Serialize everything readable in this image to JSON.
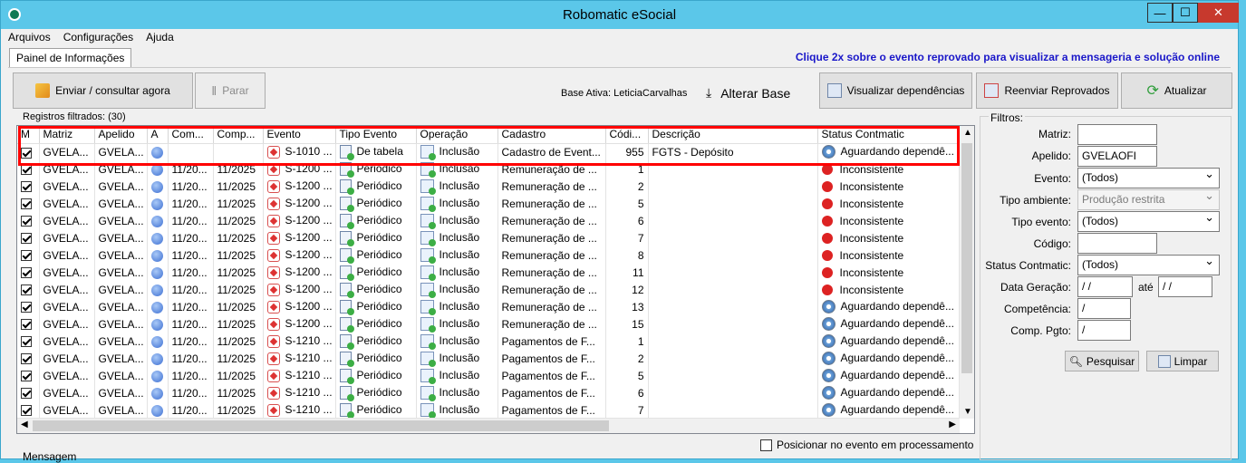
{
  "window": {
    "title": "Robomatic eSocial",
    "min": "—",
    "max": "☐",
    "close": "✕"
  },
  "menu": [
    "Arquivos",
    "Configurações",
    "Ajuda"
  ],
  "tab": "Painel de Informações",
  "hint": "Clique 2x sobre o evento reprovado para visualizar a mensageria e solução online",
  "toolbar": {
    "send": "Enviar / consultar agora",
    "stop": "Parar",
    "base_ativa": "Base Ativa: LeticiaCarvalhas",
    "alterar_base": "Alterar Base",
    "view_deps": "Visualizar dependências",
    "resend": "Reenviar Reprovados",
    "update": "Atualizar"
  },
  "grid": {
    "count_label": "Registros filtrados: (30)",
    "columns": [
      "M",
      "Matriz",
      "Apelido",
      "A",
      "Com...",
      "Comp...",
      "Evento",
      "Tipo Evento",
      "Operação",
      "Cadastro",
      "Códi...",
      "Descrição",
      "Status Contmatic"
    ],
    "rows": [
      [
        "GVELA...",
        "GVELA...",
        "",
        "",
        "S-1010 ...",
        "De tabela",
        "Inclusão",
        "Cadastro de Event...",
        "955",
        "FGTS - Depósito",
        "Aguardando dependê...",
        "wait"
      ],
      [
        "GVELA...",
        "GVELA...",
        "11/20...",
        "11/2025",
        "S-1200 ...",
        "Periódico",
        "Inclusão",
        "Remuneração de ...",
        "1",
        "",
        "Inconsistente",
        "err"
      ],
      [
        "GVELA...",
        "GVELA...",
        "11/20...",
        "11/2025",
        "S-1200 ...",
        "Periódico",
        "Inclusão",
        "Remuneração de ...",
        "2",
        "",
        "Inconsistente",
        "err"
      ],
      [
        "GVELA...",
        "GVELA...",
        "11/20...",
        "11/2025",
        "S-1200 ...",
        "Periódico",
        "Inclusão",
        "Remuneração de ...",
        "5",
        "",
        "Inconsistente",
        "err"
      ],
      [
        "GVELA...",
        "GVELA...",
        "11/20...",
        "11/2025",
        "S-1200 ...",
        "Periódico",
        "Inclusão",
        "Remuneração de ...",
        "6",
        "",
        "Inconsistente",
        "err"
      ],
      [
        "GVELA...",
        "GVELA...",
        "11/20...",
        "11/2025",
        "S-1200 ...",
        "Periódico",
        "Inclusão",
        "Remuneração de ...",
        "7",
        "",
        "Inconsistente",
        "err"
      ],
      [
        "GVELA...",
        "GVELA...",
        "11/20...",
        "11/2025",
        "S-1200 ...",
        "Periódico",
        "Inclusão",
        "Remuneração de ...",
        "8",
        "",
        "Inconsistente",
        "err"
      ],
      [
        "GVELA...",
        "GVELA...",
        "11/20...",
        "11/2025",
        "S-1200 ...",
        "Periódico",
        "Inclusão",
        "Remuneração de ...",
        "11",
        "",
        "Inconsistente",
        "err"
      ],
      [
        "GVELA...",
        "GVELA...",
        "11/20...",
        "11/2025",
        "S-1200 ...",
        "Periódico",
        "Inclusão",
        "Remuneração de ...",
        "12",
        "",
        "Inconsistente",
        "err"
      ],
      [
        "GVELA...",
        "GVELA...",
        "11/20...",
        "11/2025",
        "S-1200 ...",
        "Periódico",
        "Inclusão",
        "Remuneração de ...",
        "13",
        "",
        "Aguardando dependê...",
        "wait"
      ],
      [
        "GVELA...",
        "GVELA...",
        "11/20...",
        "11/2025",
        "S-1200 ...",
        "Periódico",
        "Inclusão",
        "Remuneração de ...",
        "15",
        "",
        "Aguardando dependê...",
        "wait"
      ],
      [
        "GVELA...",
        "GVELA...",
        "11/20...",
        "11/2025",
        "S-1210 ...",
        "Periódico",
        "Inclusão",
        "Pagamentos de F...",
        "1",
        "",
        "Aguardando dependê...",
        "wait"
      ],
      [
        "GVELA...",
        "GVELA...",
        "11/20...",
        "11/2025",
        "S-1210 ...",
        "Periódico",
        "Inclusão",
        "Pagamentos de F...",
        "2",
        "",
        "Aguardando dependê...",
        "wait"
      ],
      [
        "GVELA...",
        "GVELA...",
        "11/20...",
        "11/2025",
        "S-1210 ...",
        "Periódico",
        "Inclusão",
        "Pagamentos de F...",
        "5",
        "",
        "Aguardando dependê...",
        "wait"
      ],
      [
        "GVELA...",
        "GVELA...",
        "11/20...",
        "11/2025",
        "S-1210 ...",
        "Periódico",
        "Inclusão",
        "Pagamentos de F...",
        "6",
        "",
        "Aguardando dependê...",
        "wait"
      ],
      [
        "GVELA...",
        "GVELA...",
        "11/20...",
        "11/2025",
        "S-1210 ...",
        "Periódico",
        "Inclusão",
        "Pagamentos de F...",
        "7",
        "",
        "Aguardando dependê...",
        "wait"
      ]
    ],
    "position_label": "Posicionar no evento em processamento",
    "message_label": "Mensagem"
  },
  "filters": {
    "title": "Filtros:",
    "matriz_label": "Matriz:",
    "matriz_value": "",
    "apelido_label": "Apelido:",
    "apelido_value": "GVELAOFI",
    "evento_label": "Evento:",
    "evento_value": "(Todos)",
    "tipo_ambiente_label": "Tipo ambiente:",
    "tipo_ambiente_value": "Produção restrita",
    "tipo_evento_label": "Tipo evento:",
    "tipo_evento_value": "(Todos)",
    "codigo_label": "Código:",
    "codigo_value": "",
    "status_label": "Status Contmatic:",
    "status_value": "(Todos)",
    "data_geracao_label": "Data Geração:",
    "data_geracao_from": " /  /",
    "ate_label": "até",
    "data_geracao_to": " /  /",
    "competencia_label": "Competência:",
    "competencia_value": " /",
    "comp_pgto_label": "Comp. Pgto:",
    "comp_pgto_value": " /",
    "search": "Pesquisar",
    "clear": "Limpar"
  }
}
